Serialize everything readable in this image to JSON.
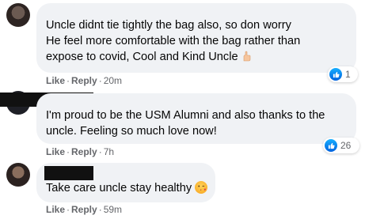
{
  "comments": [
    {
      "lines": [
        "Uncle didnt tie tightly the bag also, so don worry",
        "He feel more comfortable with the bag rather than",
        "expose to covid, Cool and Kind Uncle"
      ],
      "emoji": "thumbs-up-icon",
      "reaction_count": "1",
      "like_label": "Like",
      "reply_label": "Reply",
      "time": "20m"
    },
    {
      "lines": [
        "I'm proud to be the USM Alumni and also thanks to the",
        "uncle. Feeling so much love now!"
      ],
      "reaction_count": "26",
      "like_label": "Like",
      "reply_label": "Reply",
      "time": "7h"
    },
    {
      "lines": [
        "Take care uncle stay healthy"
      ],
      "emoji": "kissing-heart-face-icon",
      "like_label": "Like",
      "reply_label": "Reply",
      "time": "59m"
    }
  ],
  "separator": "·",
  "colors": {
    "bubble": "#f0f2f5",
    "text": "#050505",
    "meta": "#65676b",
    "like_blue": "#1877f2",
    "redaction": "#111111"
  }
}
